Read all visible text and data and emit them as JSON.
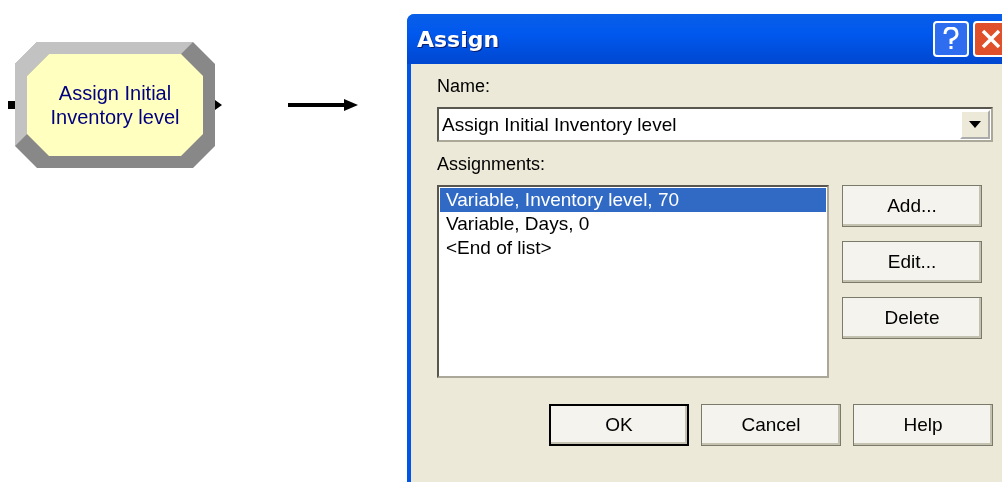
{
  "module": {
    "label": "Assign Initial\nInventory level"
  },
  "dialog": {
    "title": "Assign",
    "name_label": "Name:",
    "name_value": "Assign Initial Inventory level",
    "assignments_label": "Assignments:",
    "assignments": [
      {
        "text": "Variable, Inventory level, 70",
        "selected": true
      },
      {
        "text": "Variable, Days, 0",
        "selected": false
      },
      {
        "text": "<End of list>",
        "selected": false
      }
    ],
    "side_buttons": [
      "Add...",
      "Edit...",
      "Delete"
    ],
    "footer_buttons": [
      {
        "label": "OK",
        "default": true
      },
      {
        "label": "Cancel",
        "default": false
      },
      {
        "label": "Help",
        "default": false
      }
    ]
  }
}
